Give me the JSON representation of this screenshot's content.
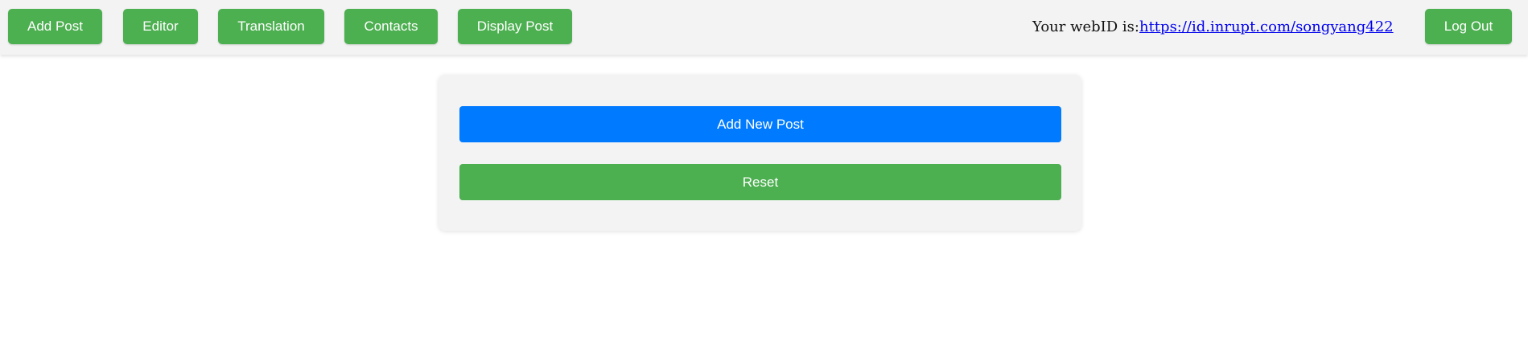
{
  "nav": {
    "buttons": [
      {
        "label": "Add Post"
      },
      {
        "label": "Editor"
      },
      {
        "label": "Translation"
      },
      {
        "label": "Contacts"
      },
      {
        "label": "Display Post"
      }
    ],
    "webid_prefix": "Your webID is:",
    "webid_link": "https://id.inrupt.com/songyang422",
    "logout_label": "Log Out"
  },
  "form": {
    "add_new_post_label": "Add New Post",
    "reset_label": "Reset"
  },
  "colors": {
    "nav_button": "#4caf50",
    "primary_button": "#007bff",
    "topbar_bg": "#f3f3f3",
    "link": "#0000ee"
  }
}
